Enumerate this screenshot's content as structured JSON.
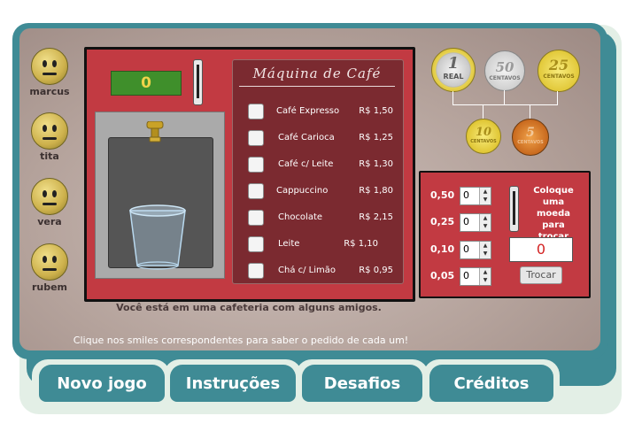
{
  "friends": [
    {
      "name": "marcus",
      "icon": "smiley-icon"
    },
    {
      "name": "tita",
      "icon": "smiley-icon"
    },
    {
      "name": "vera",
      "icon": "smiley-icon"
    },
    {
      "name": "rubem",
      "icon": "smiley-icon"
    }
  ],
  "machine": {
    "display_value": "0",
    "menu_title": "Máquina de Café",
    "items": [
      {
        "name": "Café Expresso",
        "price": "R$ 1,50"
      },
      {
        "name": "Café Carioca",
        "price": "R$ 1,25"
      },
      {
        "name": "Café c/ Leite",
        "price": "R$ 1,30"
      },
      {
        "name": "Cappuccino",
        "price": "R$ 1,80"
      },
      {
        "name": "Chocolate",
        "price": "R$ 2,15"
      },
      {
        "name": "Leite",
        "price": "R$ 1,10"
      },
      {
        "name": "Chá c/ Limão",
        "price": "R$ 0,95"
      }
    ]
  },
  "coins": {
    "c1": {
      "value": "1",
      "unit": "REAL"
    },
    "c50": {
      "value": "50",
      "unit": "CENTAVOS"
    },
    "c25": {
      "value": "25",
      "unit": "CENTAVOS"
    },
    "c10": {
      "value": "10",
      "unit": "CENTAVOS"
    },
    "c5": {
      "value": "5",
      "unit": "CENTAVOS"
    }
  },
  "change": {
    "rows": [
      {
        "label": "0,50",
        "count": "0"
      },
      {
        "label": "0,25",
        "count": "0"
      },
      {
        "label": "0,10",
        "count": "0"
      },
      {
        "label": "0,05",
        "count": "0"
      }
    ],
    "instruction_line1": "Coloque",
    "instruction_line2": "uma",
    "instruction_line3": "moeda",
    "instruction_line4": "para trocar",
    "value": "0",
    "button": "Trocar"
  },
  "caption": "Você está em uma cafeteria com alguns amigos.",
  "hint": "Clique nos smiles correspondentes para saber o pedido de cada um!",
  "tabs": [
    "Novo jogo",
    "Instruções",
    "Desafios",
    "Créditos"
  ],
  "colors": {
    "teal": "#3f8b95",
    "machine_red": "#c23a42",
    "menu_dark": "#7b2a30"
  }
}
